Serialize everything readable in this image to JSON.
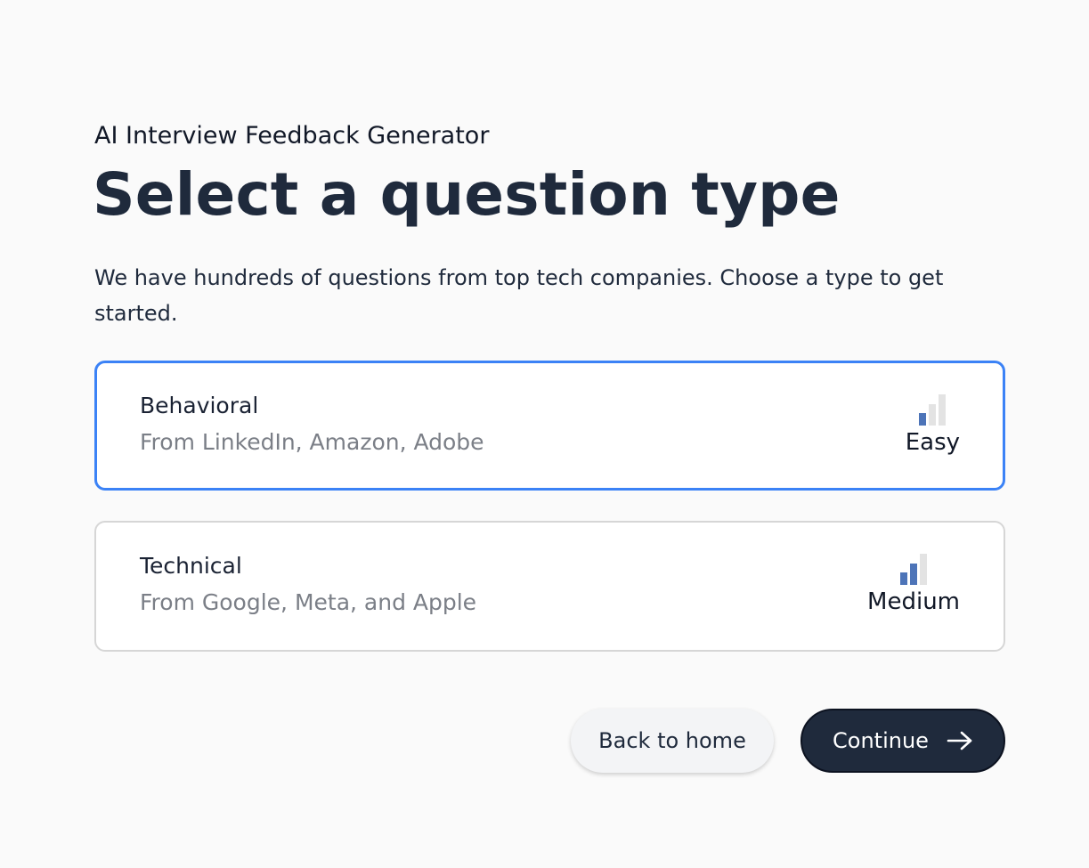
{
  "header": {
    "eyebrow": "AI Interview Feedback Generator",
    "title": "Select a question type",
    "intro": "We have hundreds of questions from top tech companies. Choose a type to get started."
  },
  "options": [
    {
      "title": "Behavioral",
      "subtitle": "From LinkedIn, Amazon, Adobe",
      "difficulty": "Easy",
      "difficulty_level": 1,
      "selected": true
    },
    {
      "title": "Technical",
      "subtitle": "From Google, Meta, and Apple",
      "difficulty": "Medium",
      "difficulty_level": 2,
      "selected": false
    }
  ],
  "actions": {
    "back_label": "Back to home",
    "continue_label": "Continue",
    "continue_icon": "arrow-right-icon"
  },
  "colors": {
    "accent": "#3b82f6",
    "bar_active": "#4d74b8",
    "bar_inactive": "#e3e3e3",
    "primary_button": "#1f2a3c"
  }
}
